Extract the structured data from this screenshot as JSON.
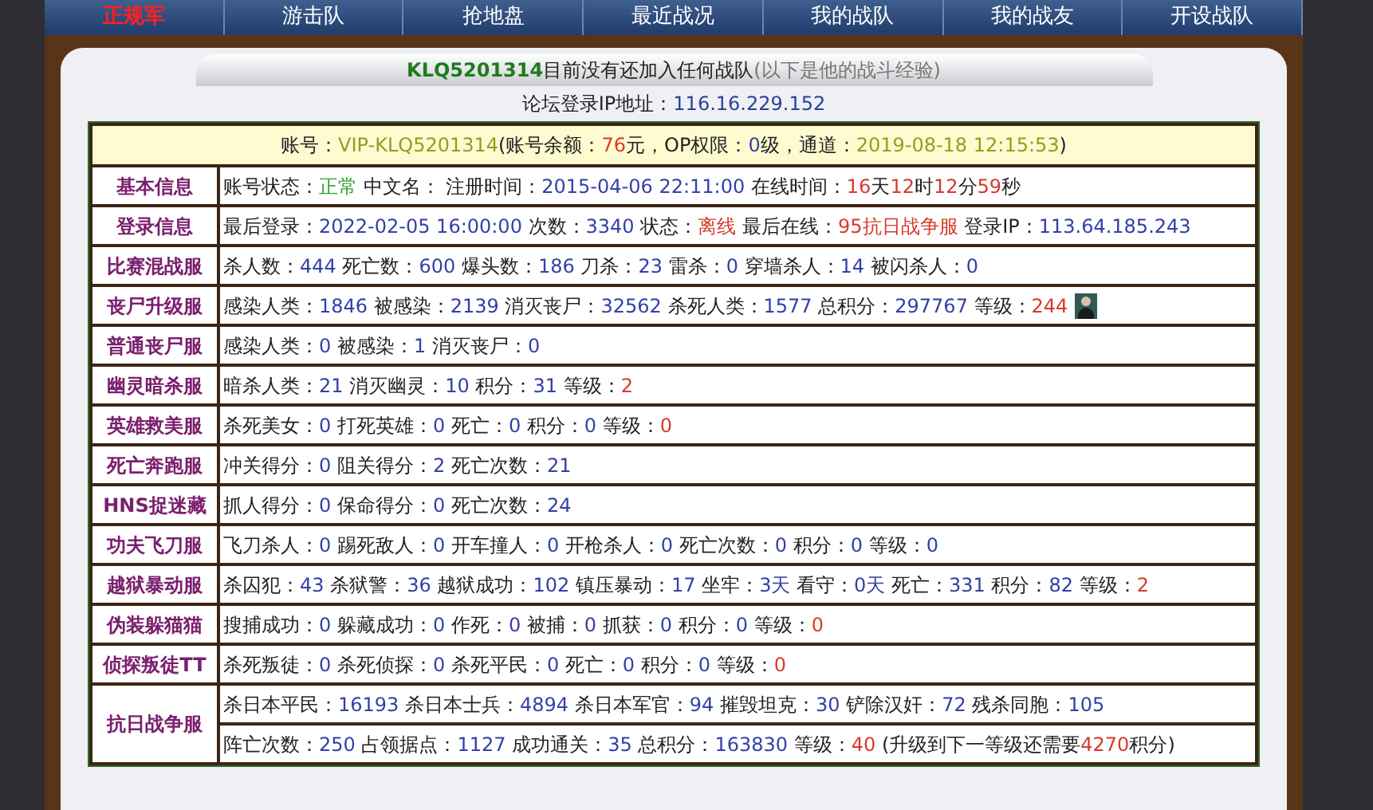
{
  "nav": [
    {
      "label": "正规军",
      "selected": true
    },
    {
      "label": "游击队",
      "selected": false
    },
    {
      "label": "抢地盘",
      "selected": false
    },
    {
      "label": "最近战况",
      "selected": false
    },
    {
      "label": "我的战队",
      "selected": false
    },
    {
      "label": "我的战友",
      "selected": false
    },
    {
      "label": "开设战队",
      "selected": false
    }
  ],
  "banner": {
    "player": "KLQ5201314",
    "message": "目前没有还加入任何战队",
    "note": "(以下是他的战斗经验)"
  },
  "forum_ip": {
    "label": "论坛登录IP地址：",
    "value": "116.16.229.152"
  },
  "account_line": [
    {
      "text": "账号：",
      "kind": "label"
    },
    {
      "text": "VIP-KLQ5201314",
      "kind": "date"
    },
    {
      "text": "(账号余额：",
      "kind": "label"
    },
    {
      "text": "76",
      "kind": "warn"
    },
    {
      "text": "元，OP权限：",
      "kind": "label"
    },
    {
      "text": "0",
      "kind": "value"
    },
    {
      "text": "级，通道：",
      "kind": "label"
    },
    {
      "text": "2019-08-18 12:15:53",
      "kind": "date"
    },
    {
      "text": ")",
      "kind": "label"
    }
  ],
  "rows": [
    {
      "title": "基本信息",
      "lines": [
        [
          {
            "text": "账号状态：",
            "kind": "label"
          },
          {
            "text": "正常",
            "kind": "ok"
          },
          {
            "text": " 中文名： 注册时间：",
            "kind": "label"
          },
          {
            "text": "2015-04-06 22:11:00",
            "kind": "value"
          },
          {
            "text": " 在线时间：",
            "kind": "label"
          },
          {
            "text": "16",
            "kind": "warn"
          },
          {
            "text": "天",
            "kind": "label"
          },
          {
            "text": "12",
            "kind": "warn"
          },
          {
            "text": "时",
            "kind": "label"
          },
          {
            "text": "12",
            "kind": "warn"
          },
          {
            "text": "分",
            "kind": "label"
          },
          {
            "text": "59",
            "kind": "warn"
          },
          {
            "text": "秒",
            "kind": "label"
          }
        ]
      ]
    },
    {
      "title": "登录信息",
      "lines": [
        [
          {
            "text": "最后登录：",
            "kind": "label"
          },
          {
            "text": "2022-02-05 16:00:00",
            "kind": "value"
          },
          {
            "text": " 次数：",
            "kind": "label"
          },
          {
            "text": "3340",
            "kind": "value"
          },
          {
            "text": " 状态：",
            "kind": "label"
          },
          {
            "text": "离线",
            "kind": "warn"
          },
          {
            "text": " 最后在线：",
            "kind": "label"
          },
          {
            "text": "95抗日战争服",
            "kind": "warn"
          },
          {
            "text": " 登录IP：",
            "kind": "label"
          },
          {
            "text": "113.64.185.243",
            "kind": "value"
          }
        ]
      ]
    },
    {
      "title": "比赛混战服",
      "lines": [
        [
          {
            "text": "杀人数：",
            "kind": "label"
          },
          {
            "text": "444",
            "kind": "value"
          },
          {
            "text": " 死亡数：",
            "kind": "label"
          },
          {
            "text": "600",
            "kind": "value"
          },
          {
            "text": " 爆头数：",
            "kind": "label"
          },
          {
            "text": "186",
            "kind": "value"
          },
          {
            "text": " 刀杀：",
            "kind": "label"
          },
          {
            "text": "23",
            "kind": "value"
          },
          {
            "text": " 雷杀：",
            "kind": "label"
          },
          {
            "text": "0",
            "kind": "value"
          },
          {
            "text": " 穿墙杀人：",
            "kind": "label"
          },
          {
            "text": "14",
            "kind": "value"
          },
          {
            "text": " 被闪杀人：",
            "kind": "label"
          },
          {
            "text": "0",
            "kind": "value"
          }
        ]
      ]
    },
    {
      "title": "丧尸升级服",
      "lines": [
        [
          {
            "text": "感染人类：",
            "kind": "label"
          },
          {
            "text": "1846",
            "kind": "value"
          },
          {
            "text": " 被感染：",
            "kind": "label"
          },
          {
            "text": "2139",
            "kind": "value"
          },
          {
            "text": " 消灭丧尸：",
            "kind": "label"
          },
          {
            "text": "32562",
            "kind": "value"
          },
          {
            "text": " 杀死人类：",
            "kind": "label"
          },
          {
            "text": "1577",
            "kind": "value"
          },
          {
            "text": " 总积分：",
            "kind": "label"
          },
          {
            "text": "297767",
            "kind": "value"
          },
          {
            "text": " 等级：",
            "kind": "label"
          },
          {
            "text": "244",
            "kind": "warn"
          },
          {
            "kind": "avatar"
          }
        ]
      ]
    },
    {
      "title": "普通丧尸服",
      "lines": [
        [
          {
            "text": "感染人类：",
            "kind": "label"
          },
          {
            "text": "0",
            "kind": "value"
          },
          {
            "text": " 被感染：",
            "kind": "label"
          },
          {
            "text": "1",
            "kind": "value"
          },
          {
            "text": " 消灭丧尸：",
            "kind": "label"
          },
          {
            "text": "0",
            "kind": "value"
          }
        ]
      ]
    },
    {
      "title": "幽灵暗杀服",
      "lines": [
        [
          {
            "text": "暗杀人类：",
            "kind": "label"
          },
          {
            "text": "21",
            "kind": "value"
          },
          {
            "text": " 消灭幽灵：",
            "kind": "label"
          },
          {
            "text": "10",
            "kind": "value"
          },
          {
            "text": " 积分：",
            "kind": "label"
          },
          {
            "text": "31",
            "kind": "value"
          },
          {
            "text": " 等级：",
            "kind": "label"
          },
          {
            "text": "2",
            "kind": "warn"
          }
        ]
      ]
    },
    {
      "title": "英雄救美服",
      "lines": [
        [
          {
            "text": "杀死美女：",
            "kind": "label"
          },
          {
            "text": "0",
            "kind": "value"
          },
          {
            "text": " 打死英雄：",
            "kind": "label"
          },
          {
            "text": "0",
            "kind": "value"
          },
          {
            "text": " 死亡：",
            "kind": "label"
          },
          {
            "text": "0",
            "kind": "value"
          },
          {
            "text": " 积分：",
            "kind": "label"
          },
          {
            "text": "0",
            "kind": "value"
          },
          {
            "text": " 等级：",
            "kind": "label"
          },
          {
            "text": "0",
            "kind": "warn"
          }
        ]
      ]
    },
    {
      "title": "死亡奔跑服",
      "lines": [
        [
          {
            "text": "冲关得分：",
            "kind": "label"
          },
          {
            "text": "0",
            "kind": "value"
          },
          {
            "text": " 阻关得分：",
            "kind": "label"
          },
          {
            "text": "2",
            "kind": "value"
          },
          {
            "text": " 死亡次数：",
            "kind": "label"
          },
          {
            "text": "21",
            "kind": "value"
          }
        ]
      ]
    },
    {
      "title": "HNS捉迷藏",
      "lines": [
        [
          {
            "text": "抓人得分：",
            "kind": "label"
          },
          {
            "text": "0",
            "kind": "value"
          },
          {
            "text": " 保命得分：",
            "kind": "label"
          },
          {
            "text": "0",
            "kind": "value"
          },
          {
            "text": " 死亡次数：",
            "kind": "label"
          },
          {
            "text": "24",
            "kind": "value"
          }
        ]
      ]
    },
    {
      "title": "功夫飞刀服",
      "lines": [
        [
          {
            "text": "飞刀杀人：",
            "kind": "label"
          },
          {
            "text": "0",
            "kind": "value"
          },
          {
            "text": " 踢死敌人：",
            "kind": "label"
          },
          {
            "text": "0",
            "kind": "value"
          },
          {
            "text": " 开车撞人：",
            "kind": "label"
          },
          {
            "text": "0",
            "kind": "value"
          },
          {
            "text": " 开枪杀人：",
            "kind": "label"
          },
          {
            "text": "0",
            "kind": "value"
          },
          {
            "text": " 死亡次数：",
            "kind": "label"
          },
          {
            "text": "0",
            "kind": "value"
          },
          {
            "text": " 积分：",
            "kind": "label"
          },
          {
            "text": "0",
            "kind": "value"
          },
          {
            "text": " 等级：",
            "kind": "label"
          },
          {
            "text": "0",
            "kind": "value"
          }
        ]
      ]
    },
    {
      "title": "越狱暴动服",
      "lines": [
        [
          {
            "text": "杀囚犯：",
            "kind": "label"
          },
          {
            "text": "43",
            "kind": "value"
          },
          {
            "text": " 杀狱警：",
            "kind": "label"
          },
          {
            "text": "36",
            "kind": "value"
          },
          {
            "text": " 越狱成功：",
            "kind": "label"
          },
          {
            "text": "102",
            "kind": "value"
          },
          {
            "text": " 镇压暴动：",
            "kind": "label"
          },
          {
            "text": "17",
            "kind": "value"
          },
          {
            "text": " 坐牢：",
            "kind": "label"
          },
          {
            "text": "3天",
            "kind": "value"
          },
          {
            "text": " 看守：",
            "kind": "label"
          },
          {
            "text": "0天",
            "kind": "value"
          },
          {
            "text": " 死亡：",
            "kind": "label"
          },
          {
            "text": "331",
            "kind": "value"
          },
          {
            "text": " 积分：",
            "kind": "label"
          },
          {
            "text": "82",
            "kind": "value"
          },
          {
            "text": " 等级：",
            "kind": "label"
          },
          {
            "text": "2",
            "kind": "warn"
          }
        ]
      ]
    },
    {
      "title": "伪装躲猫猫",
      "lines": [
        [
          {
            "text": "搜捕成功：",
            "kind": "label"
          },
          {
            "text": "0",
            "kind": "value"
          },
          {
            "text": " 躲藏成功：",
            "kind": "label"
          },
          {
            "text": "0",
            "kind": "value"
          },
          {
            "text": " 作死：",
            "kind": "label"
          },
          {
            "text": "0",
            "kind": "value"
          },
          {
            "text": " 被捕：",
            "kind": "label"
          },
          {
            "text": "0",
            "kind": "value"
          },
          {
            "text": " 抓获：",
            "kind": "label"
          },
          {
            "text": "0",
            "kind": "value"
          },
          {
            "text": " 积分：",
            "kind": "label"
          },
          {
            "text": "0",
            "kind": "value"
          },
          {
            "text": " 等级：",
            "kind": "label"
          },
          {
            "text": "0",
            "kind": "warn"
          }
        ]
      ]
    },
    {
      "title": "侦探叛徒TT",
      "lines": [
        [
          {
            "text": "杀死叛徒：",
            "kind": "label"
          },
          {
            "text": "0",
            "kind": "value"
          },
          {
            "text": " 杀死侦探：",
            "kind": "label"
          },
          {
            "text": "0",
            "kind": "value"
          },
          {
            "text": " 杀死平民：",
            "kind": "label"
          },
          {
            "text": "0",
            "kind": "value"
          },
          {
            "text": " 死亡：",
            "kind": "label"
          },
          {
            "text": "0",
            "kind": "value"
          },
          {
            "text": " 积分：",
            "kind": "label"
          },
          {
            "text": "0",
            "kind": "value"
          },
          {
            "text": " 等级：",
            "kind": "label"
          },
          {
            "text": "0",
            "kind": "warn"
          }
        ]
      ]
    },
    {
      "title": "抗日战争服",
      "lines": [
        [
          {
            "text": "杀日本平民：",
            "kind": "label"
          },
          {
            "text": "16193",
            "kind": "value"
          },
          {
            "text": " 杀日本士兵：",
            "kind": "label"
          },
          {
            "text": "4894",
            "kind": "value"
          },
          {
            "text": " 杀日本军官：",
            "kind": "label"
          },
          {
            "text": "94",
            "kind": "value"
          },
          {
            "text": " 摧毁坦克：",
            "kind": "label"
          },
          {
            "text": "30",
            "kind": "value"
          },
          {
            "text": " 铲除汉奸：",
            "kind": "label"
          },
          {
            "text": "72",
            "kind": "value"
          },
          {
            "text": " 残杀同胞：",
            "kind": "label"
          },
          {
            "text": "105",
            "kind": "value"
          }
        ],
        [
          {
            "text": "阵亡次数：",
            "kind": "label"
          },
          {
            "text": "250",
            "kind": "value"
          },
          {
            "text": " 占领据点：",
            "kind": "label"
          },
          {
            "text": "1127",
            "kind": "value"
          },
          {
            "text": " 成功通关：",
            "kind": "label"
          },
          {
            "text": "35",
            "kind": "value"
          },
          {
            "text": " 总积分：",
            "kind": "label"
          },
          {
            "text": "163830",
            "kind": "value"
          },
          {
            "text": " 等级：",
            "kind": "label"
          },
          {
            "text": "40",
            "kind": "warn"
          },
          {
            "text": " (升级到下一等级还需要",
            "kind": "label"
          },
          {
            "text": "4270",
            "kind": "warn"
          },
          {
            "text": "积分)",
            "kind": "label"
          }
        ]
      ]
    }
  ]
}
